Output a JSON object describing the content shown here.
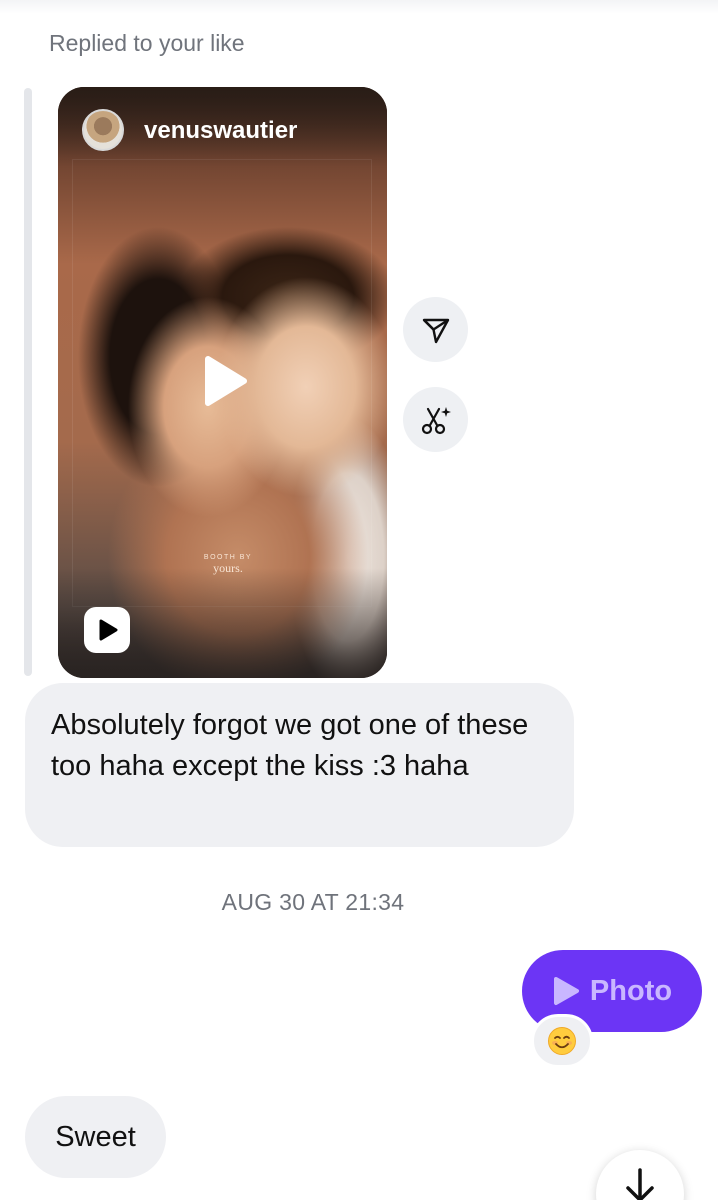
{
  "thread": {
    "reply_label": "Replied to your like",
    "shared_reel": {
      "author": "venuswautier",
      "watermark_line1": "BOOTH BY",
      "watermark_line2": "yours."
    },
    "incoming_message": "Absolutely forgot we got one of these too haha except the kiss :3 haha",
    "timestamp": "AUG 30 AT 21:34",
    "outgoing_message": {
      "label": "Photo",
      "reaction": "😊"
    },
    "last_incoming_message": "Sweet"
  },
  "icons": {
    "share": "paper-plane-icon",
    "remix": "scissors-sparkle-icon",
    "play": "play-icon",
    "reel_badge": "reel-icon",
    "scroll_down": "arrow-down-icon"
  },
  "colors": {
    "outgoing_bubble": "#6c35f5",
    "outgoing_text": "#c9b7ff",
    "incoming_bubble": "#eff0f3",
    "meta_text": "#70747c"
  }
}
